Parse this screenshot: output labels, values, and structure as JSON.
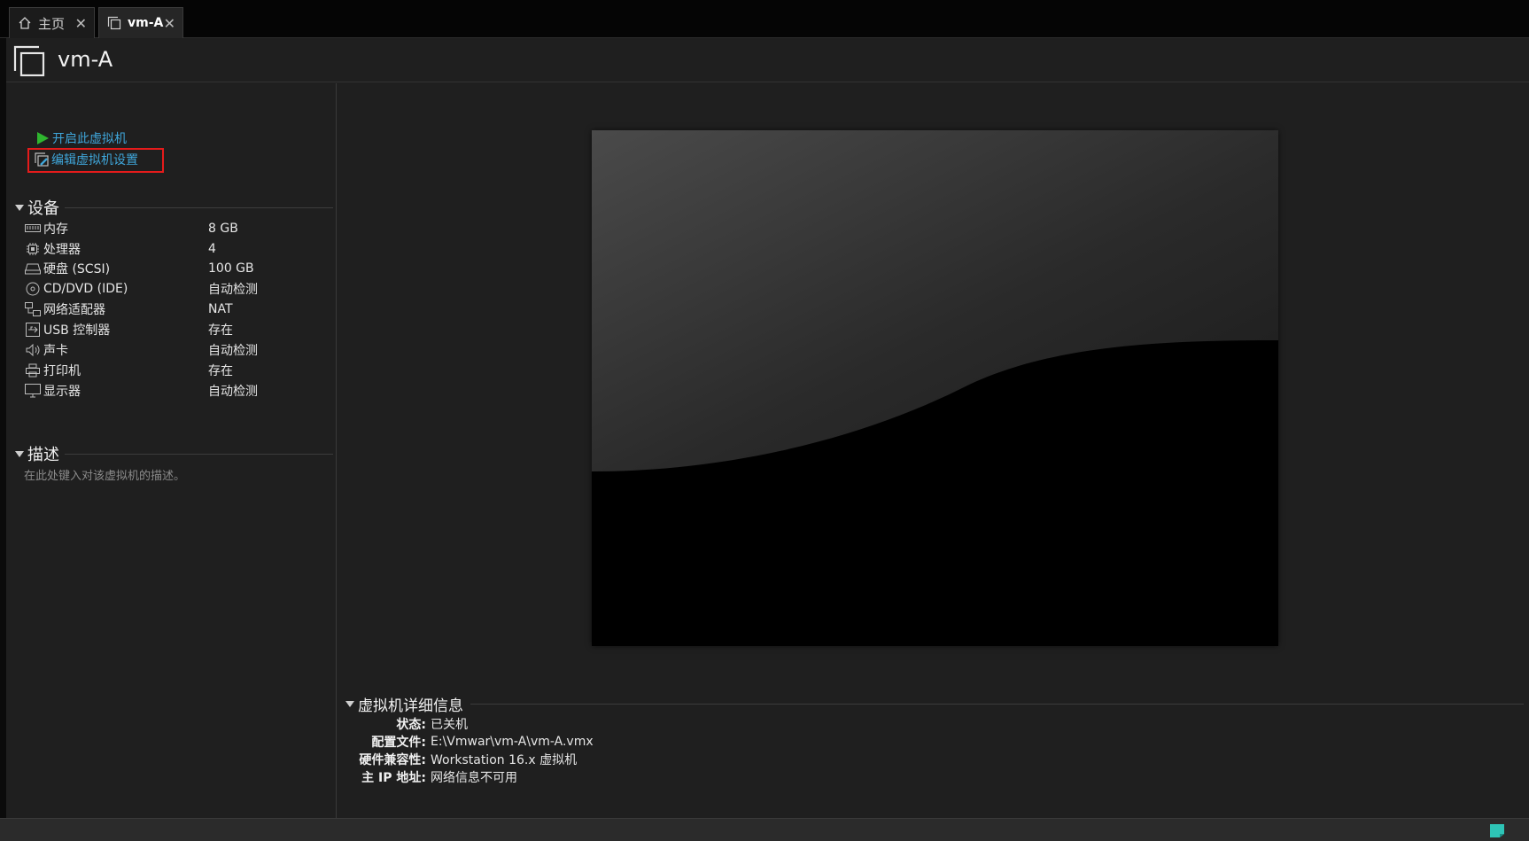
{
  "tabs": [
    {
      "label": "主页",
      "icon": "home-icon"
    },
    {
      "label": "vm-A",
      "icon": "vm-icon"
    }
  ],
  "vm": {
    "title": "vm-A"
  },
  "actions": {
    "start": "开启此虚拟机",
    "edit": "编辑虚拟机设置"
  },
  "devices": {
    "heading": "设备",
    "items": [
      {
        "name": "内存",
        "value": "8 GB",
        "icon": "memory-icon"
      },
      {
        "name": "处理器",
        "value": "4",
        "icon": "cpu-icon"
      },
      {
        "name": "硬盘 (SCSI)",
        "value": "100 GB",
        "icon": "hard-disk-icon"
      },
      {
        "name": "CD/DVD (IDE)",
        "value": "自动检测",
        "icon": "cd-dvd-icon"
      },
      {
        "name": "网络适配器",
        "value": "NAT",
        "icon": "network-adapter-icon"
      },
      {
        "name": "USB 控制器",
        "value": "存在",
        "icon": "usb-icon"
      },
      {
        "name": "声卡",
        "value": "自动检测",
        "icon": "sound-card-icon"
      },
      {
        "name": "打印机",
        "value": "存在",
        "icon": "printer-icon"
      },
      {
        "name": "显示器",
        "value": "自动检测",
        "icon": "display-icon"
      }
    ]
  },
  "description": {
    "heading": "描述",
    "placeholder": "在此处键入对该虚拟机的描述。"
  },
  "details": {
    "heading": "虚拟机详细信息",
    "rows": [
      {
        "key": "状态:",
        "value": "已关机"
      },
      {
        "key": "配置文件:",
        "value": "E:\\Vmwar\\vm-A\\vm-A.vmx"
      },
      {
        "key": "硬件兼容性:",
        "value": "Workstation 16.x 虚拟机"
      },
      {
        "key": "主 IP 地址:",
        "value": "网络信息不可用"
      }
    ]
  },
  "colors": {
    "accent_link": "#3fa5d9",
    "highlight": "#e51b1b",
    "play_green": "#2fb52f",
    "status_teal": "#2ec4b6"
  }
}
